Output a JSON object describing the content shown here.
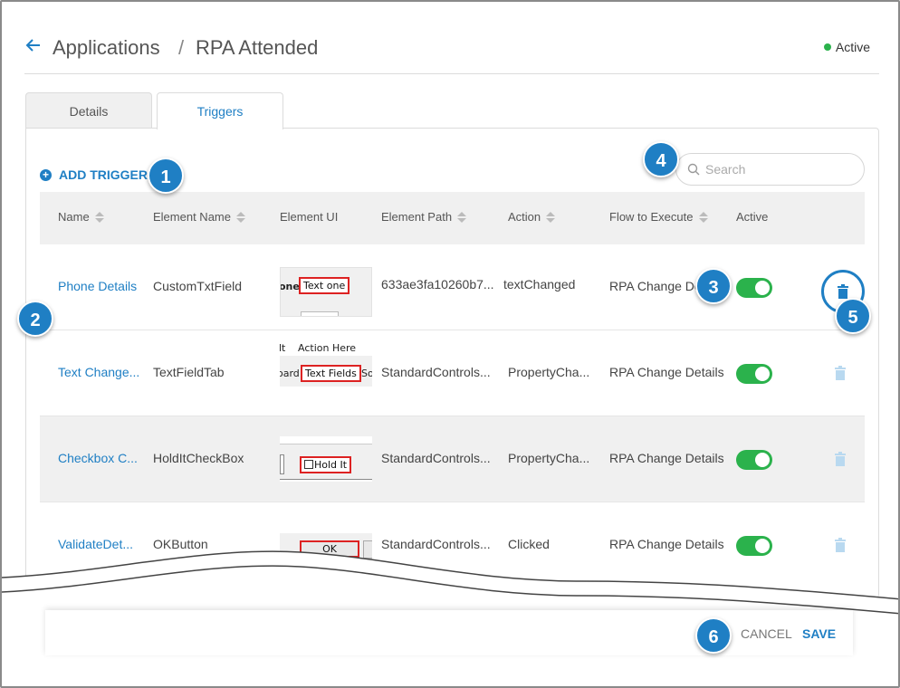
{
  "header": {
    "breadcrumb_root": "Applications",
    "breadcrumb_sep": "/",
    "breadcrumb_current": "RPA Attended",
    "status": "Active",
    "status_color": "#2bb24c"
  },
  "tabs": [
    {
      "label": "Details"
    },
    {
      "label": "Triggers"
    }
  ],
  "toolbar": {
    "add_trigger": "ADD TRIGGER",
    "search_placeholder": "Search"
  },
  "table": {
    "columns": [
      "Name",
      "Element Name",
      "Element UI",
      "Element Path",
      "Action",
      "Flow to Execute",
      "Active"
    ],
    "rows": [
      {
        "name": "Phone Details",
        "element_name": "CustomTxtField",
        "element_ui": {
          "boxed": "Text one",
          "fragments": [
            "one"
          ]
        },
        "element_path": "633ae3fa10260b7...",
        "action": "textChanged",
        "flow": "RPA Change Det",
        "active": true
      },
      {
        "name": "Text Change...",
        "element_name": "TextFieldTab",
        "element_ui": {
          "boxed": "Text Fields",
          "fragments": [
            "lt",
            "Action Here",
            "oard",
            "So"
          ]
        },
        "element_path": "StandardControls...",
        "action": "PropertyCha...",
        "flow": "RPA Change Details",
        "active": true
      },
      {
        "name": "Checkbox C...",
        "element_name": "HoldItCheckBox",
        "element_ui": {
          "boxed": "Hold It",
          "fragments": []
        },
        "element_path": "StandardControls...",
        "action": "PropertyCha...",
        "flow": "RPA Change Details",
        "active": true
      },
      {
        "name": "ValidateDet...",
        "element_name": "OKButton",
        "element_ui": {
          "boxed": "OK",
          "fragments": []
        },
        "element_path": "StandardControls...",
        "action": "Clicked",
        "flow": "RPA Change Details",
        "active": true
      }
    ]
  },
  "footer": {
    "cancel": "CANCEL",
    "save": "SAVE"
  },
  "callouts": [
    "1",
    "2",
    "3",
    "4",
    "5",
    "6"
  ],
  "colors": {
    "accent": "#1f7fc4",
    "toggle_on": "#2bb24c",
    "highlight_box": "#dd2222"
  }
}
